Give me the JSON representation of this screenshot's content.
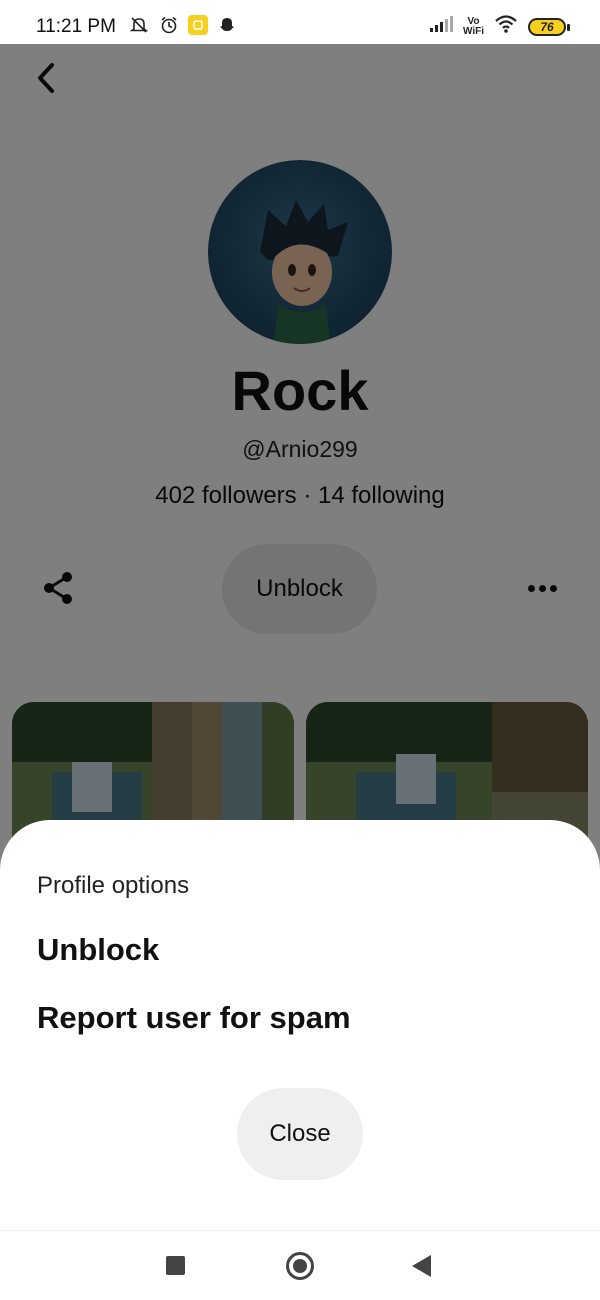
{
  "status_bar": {
    "time": "11:21 PM",
    "left_icons": [
      "bell-off-icon",
      "alarm-icon",
      "snapchat-icon",
      "snapchat-ghost-icon"
    ],
    "vowifi_top": "Vo",
    "vowifi_bottom": "WiFi",
    "battery_level": "76"
  },
  "profile": {
    "name": "Rock",
    "handle": "@Arnio299",
    "stats": "402 followers · 14 following",
    "primary_button_label": "Unblock"
  },
  "sheet": {
    "title": "Profile options",
    "items": [
      {
        "label": "Unblock"
      },
      {
        "label": "Report user for spam"
      }
    ],
    "close_label": "Close"
  },
  "colors": {
    "snapchat_yellow": "#f6cf1f",
    "dim_overlay": "rgba(0,0,0,0.5)",
    "button_gray": "#e9e9e9"
  }
}
